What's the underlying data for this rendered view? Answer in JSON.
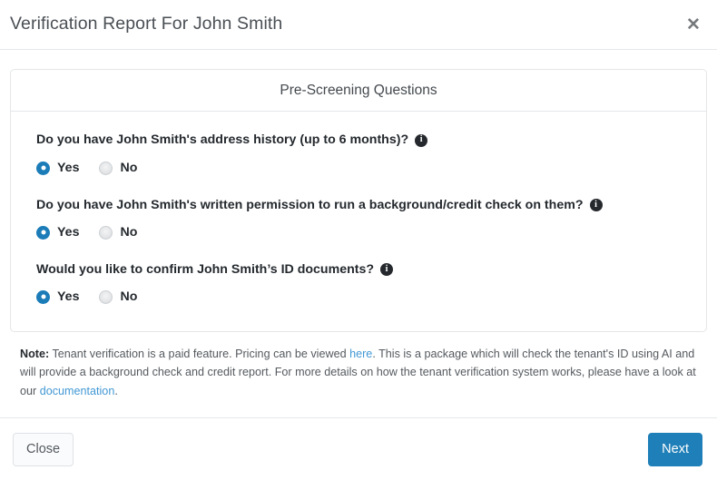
{
  "header": {
    "title": "Verification Report For John Smith",
    "close_label": "✕"
  },
  "card": {
    "heading": "Pre-Screening Questions",
    "questions": [
      {
        "text": "Do you have John Smith's address history (up to 6 months)?",
        "info_glyph": "i",
        "options": [
          {
            "label": "Yes",
            "selected": true
          },
          {
            "label": "No",
            "selected": false
          }
        ]
      },
      {
        "text": "Do you have John Smith's written permission to run a background/credit check on them?",
        "info_glyph": "i",
        "options": [
          {
            "label": "Yes",
            "selected": true
          },
          {
            "label": "No",
            "selected": false
          }
        ]
      },
      {
        "text": "Would you like to confirm John Smith’s ID documents?",
        "info_glyph": "i",
        "options": [
          {
            "label": "Yes",
            "selected": true
          },
          {
            "label": "No",
            "selected": false
          }
        ]
      }
    ]
  },
  "note": {
    "label": "Note:",
    "part1": " Tenant verification is a paid feature. Pricing can be viewed ",
    "link1": "here",
    "part2": ". This is a package which will check the tenant's ID using AI and will provide a background check and credit report. For more details on how the tenant verification system works, please have a look at our ",
    "link2": "documentation",
    "part3": "."
  },
  "footer": {
    "close_label": "Close",
    "next_label": "Next"
  },
  "colors": {
    "accent": "#1f7fb8",
    "radio_selected": "#1b7cb8",
    "link": "#4298d4",
    "info_badge": "#25292d",
    "border": "#e4e6e8"
  }
}
